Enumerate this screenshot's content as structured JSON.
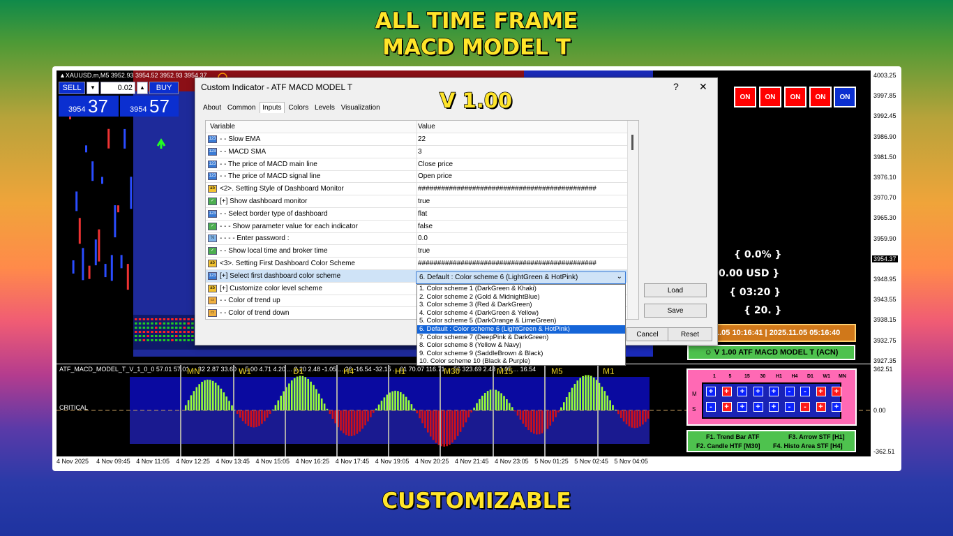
{
  "banner": {
    "line1": "ALL TIME FRAME",
    "line2": "MACD MODEL T",
    "bottom": "CUSTOMIZABLE"
  },
  "chart": {
    "symbol": "▲XAUUSD.m,M5  3952.93 3954.52 3952.93 3954.37",
    "sell_label": "SELL",
    "buy_label": "BUY",
    "lot": "0.02",
    "sell_price_small": "3954",
    "sell_price_big": "37",
    "buy_price_small": "3954",
    "buy_price_big": "57",
    "price_labels": [
      "4003.25",
      "3997.85",
      "3992.45",
      "3986.90",
      "3981.50",
      "3976.10",
      "3970.70",
      "3965.30",
      "3959.90",
      "3954.37",
      "3948.95",
      "3943.55",
      "3938.15",
      "3932.75",
      "3927.35"
    ],
    "ind_price_labels": [
      "362.51",
      "0.00",
      "-362.51"
    ],
    "time_labels": [
      "4 Nov 2025",
      "4 Nov 09:45",
      "4 Nov 11:05",
      "4 Nov 12:25",
      "4 Nov 13:45",
      "4 Nov 15:05",
      "4 Nov 16:25",
      "4 Nov 17:45",
      "4 Nov 19:05",
      "4 Nov 20:25",
      "4 Nov 21:45",
      "4 Nov 23:05",
      "5 Nov 01:25",
      "5 Nov 02:45",
      "5 Nov 04:05"
    ],
    "on_buttons": [
      "ON",
      "ON",
      "ON",
      "ON",
      "ON"
    ],
    "stats": [
      "{ 0.0% }",
      "0.00 USD }",
      "{ 03:20 }",
      "{ 20. }"
    ],
    "time_box": "1.05 10:16:41  |  2025.11.05 05:16:40",
    "version_box": "☺  V 1.00 ATF MACD MODEL T (ACN)",
    "ind_label": "ATF_MACD_MODEL_T_V_1_0_0 57.01 57.01 ... 32 2.87 33.60 ... 5.00 4.71 4.20 ... 2.20 2.48 -1.05 ... 26 -16.54 -32.15 ... 61 70.07 116.71 ... 56 323.69 2.48 -1.05 ... 16.54",
    "critical": "CRITICAL",
    "tf_labels": [
      "MN",
      "W1",
      "D1",
      "H4",
      "H1",
      "M30",
      "M15",
      "M5",
      "M1"
    ]
  },
  "dashboard": {
    "headers": [
      "1",
      "5",
      "15",
      "30",
      "H1",
      "H4",
      "D1",
      "W1",
      "MN"
    ],
    "row_m_label": "M",
    "row_s_label": "S",
    "row_m": [
      "+",
      "+",
      "+",
      "+",
      "+",
      "-",
      "-",
      "+",
      "+"
    ],
    "row_s": [
      "-",
      "+",
      "+",
      "+",
      "+",
      "-",
      "-",
      "+",
      "+"
    ],
    "row_m_colors": [
      "b",
      "r",
      "b",
      "b",
      "b",
      "b",
      "b",
      "r",
      "r"
    ],
    "row_s_colors": [
      "b",
      "r",
      "b",
      "b",
      "b",
      "b",
      "r",
      "r",
      "b"
    ],
    "keys": [
      "F1. Trend Bar ATF",
      "F3. Arrow STF [H1]",
      "F2. Candle HTF [M30]",
      "F4. Histo Area STF [H4]"
    ]
  },
  "dialog": {
    "title": "Custom Indicator - ATF MACD MODEL T",
    "help": "?",
    "close": "✕",
    "tabs": [
      "About",
      "Common",
      "Inputs",
      "Colors",
      "Levels",
      "Visualization"
    ],
    "active_tab": "Inputs",
    "col_variable": "Variable",
    "col_value": "Value",
    "rows": [
      {
        "icon": "num",
        "var": "- - Slow EMA",
        "val": "22"
      },
      {
        "icon": "num",
        "var": "- - MACD SMA",
        "val": "3"
      },
      {
        "icon": "num",
        "var": "- - The price of MACD main line",
        "val": "Close price"
      },
      {
        "icon": "num",
        "var": "- - The price of MACD signal line",
        "val": "Open price"
      },
      {
        "icon": "ab",
        "var": "<2>. Setting Style of Dashboard Monitor",
        "val": "##############################################"
      },
      {
        "icon": "bool",
        "var": "[+] Show dashboard monitor",
        "val": "true"
      },
      {
        "icon": "num",
        "var": "- - Select border type of dashboard",
        "val": "flat"
      },
      {
        "icon": "bool",
        "var": "- - - Show parameter value for each indicator",
        "val": "false"
      },
      {
        "icon": "dbl",
        "var": "- - - - Enter password :",
        "val": "0.0"
      },
      {
        "icon": "bool",
        "var": "- - Show local time and broker time",
        "val": "true"
      },
      {
        "icon": "ab",
        "var": "<3>. Setting First Dashboard Color Scheme",
        "val": "##############################################"
      },
      {
        "icon": "num",
        "var": "[+] Select first dashboard color scheme",
        "val": ""
      },
      {
        "icon": "ab",
        "var": "[+] Customize color level scheme",
        "val": ""
      },
      {
        "icon": "col",
        "var": "- - Color of trend up",
        "val": ""
      },
      {
        "icon": "col",
        "var": "- - Color of trend down",
        "val": ""
      }
    ],
    "load": "Load",
    "save": "Save",
    "cancel": "Cancel",
    "reset": "Reset",
    "combo_value": "6. Default : Color scheme 6 (LightGreen & HotPink)",
    "options": [
      "1. Color scheme 1 (DarkGreen & Khaki)",
      "2. Color scheme 2 (Gold & MidnightBlue)",
      "3. Color scheme 3 (Red & DarkGreen)",
      "4. Color scheme 4 (DarkGreen & Yellow)",
      "5. Color scheme 5 (DarkOrange & LimeGreen)",
      "6. Default : Color scheme 6 (LightGreen & HotPink)",
      "7. Color scheme 7 (DeepPink & DarkGreen)",
      "8. Color scheme 8 (Yellow & Navy)",
      "9. Color scheme 9 (SaddleBrown & Black)",
      "10. Color scheme 10 (Black & Purple)"
    ],
    "selected_option": 5
  },
  "version": "V 1.00"
}
